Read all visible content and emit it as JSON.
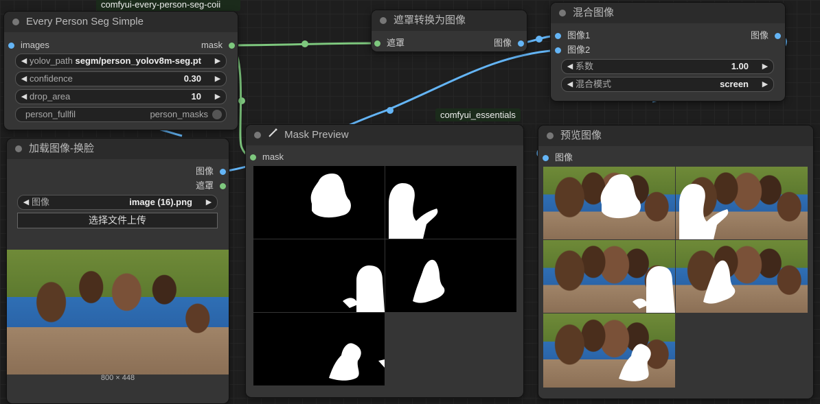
{
  "top_badge": "comfyui-every-person-seg-coii",
  "essentials_badge": "comfyui_essentials",
  "node_seg": {
    "title": "Every Person Seg Simple",
    "input_images": "images",
    "output_mask": "mask",
    "yolov_label": "yolov_path",
    "yolov_value": "segm/person_yolov8m-seg.pt",
    "confidence_label": "confidence",
    "confidence_value": "0.30",
    "drop_area_label": "drop_area",
    "drop_area_value": "10",
    "toggle_left": "person_fullfil",
    "toggle_right": "person_masks"
  },
  "node_load": {
    "title": "加载图像-换脸",
    "output_image": "图像",
    "output_mask": "遮罩",
    "image_label": "图像",
    "image_value": "image (16).png",
    "upload_button": "选择文件上传",
    "image_size": "800 × 448"
  },
  "node_convert": {
    "title": "遮罩转换为图像",
    "input": "遮罩",
    "output": "图像"
  },
  "node_blend": {
    "title": "混合图像",
    "input1": "图像1",
    "input2": "图像2",
    "output": "图像",
    "factor_label": "系数",
    "factor_value": "1.00",
    "mode_label": "混合模式",
    "mode_value": "screen"
  },
  "node_mask_preview": {
    "title": "Mask Preview",
    "input": "mask"
  },
  "node_preview": {
    "title": "预览图像",
    "input": "图像"
  },
  "colors": {
    "canvas": "#1e1e1e",
    "node_body": "#353535",
    "node_header": "#2b2b2b",
    "image_link": "#64b5f6",
    "mask_link": "#7ec87e"
  }
}
